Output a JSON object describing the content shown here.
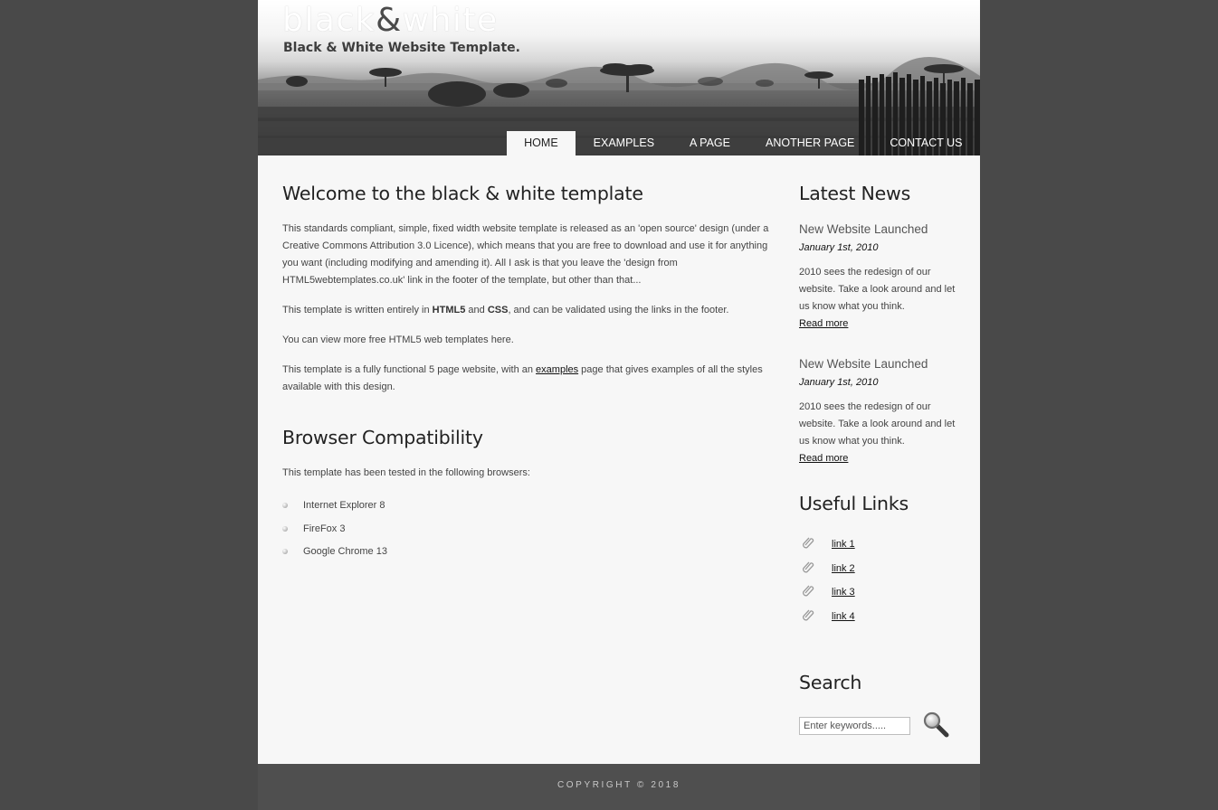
{
  "colors": {
    "page_background": "#494949",
    "content_background": "#f7f7f7",
    "footer_background": "#4f4f4f",
    "menu_selected_background": "#f7f7f7"
  },
  "header": {
    "logo_part1": "black",
    "logo_amp": "&",
    "logo_part2": "white",
    "tagline": "Black & White Website Template."
  },
  "menu": {
    "items": [
      {
        "label": "HOME",
        "selected": true
      },
      {
        "label": "EXAMPLES"
      },
      {
        "label": "A PAGE"
      },
      {
        "label": "ANOTHER PAGE"
      },
      {
        "label": "CONTACT US"
      }
    ]
  },
  "main": {
    "heading": "Welcome to the black & white template",
    "para1": "This standards compliant, simple, fixed width website template is released as an 'open source' design (under a Creative Commons Attribution 3.0 Licence), which means that you are free to download and use it for anything you want (including modifying and amending it). All I ask is that you leave the 'design from HTML5webtemplates.co.uk' link in the footer of the template, but other than that...",
    "para2_start": "This template is written entirely in ",
    "para2_html5": "HTML5",
    "para2_and": " and ",
    "para2_css": "CSS",
    "para2_end": ", and can be validated using the links in the footer.",
    "para3": "You can view more free HTML5 web templates here.",
    "para4_start": "This template is a fully functional 5 page website, with an ",
    "para4_link": "examples",
    "para4_end": " page that gives examples of all the styles available with this design.",
    "heading2": "Browser Compatibility",
    "para5": "This template has been tested in the following browsers:",
    "browsers": [
      "Internet Explorer 8",
      "FireFox 3",
      "Google Chrome 13"
    ]
  },
  "sidebar": {
    "news_heading": "Latest News",
    "news": [
      {
        "title": "New Website Launched",
        "date": "January 1st, 2010",
        "text": "2010 sees the redesign of our website. Take a look around and let us know what you think.",
        "read_more": "Read more"
      },
      {
        "title": "New Website Launched",
        "date": "January 1st, 2010",
        "text": "2010 sees the redesign of our website. Take a look around and let us know what you think.",
        "read_more": "Read more"
      }
    ],
    "links_heading": "Useful Links",
    "links": [
      "link 1",
      "link 2",
      "link 3",
      "link 4"
    ],
    "search_heading": "Search",
    "search_placeholder": "Enter keywords.....",
    "search_icon": "magnifier-icon"
  },
  "footer": {
    "copyright": "COPYRIGHT © 2018"
  }
}
